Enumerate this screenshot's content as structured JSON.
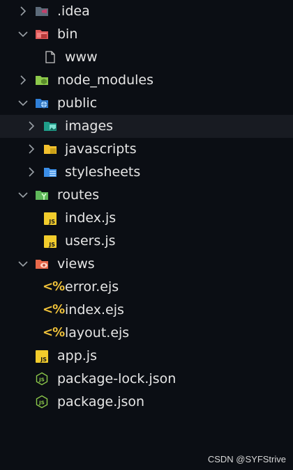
{
  "tree": {
    "idea": {
      "label": ".idea",
      "expanded": false,
      "icon": "idea-folder-icon"
    },
    "bin": {
      "label": "bin",
      "expanded": true,
      "icon": "bin-folder-icon"
    },
    "www": {
      "label": "www",
      "icon": "file-icon"
    },
    "node_modules": {
      "label": "node_modules",
      "expanded": false,
      "icon": "node-modules-folder-icon"
    },
    "public": {
      "label": "public",
      "expanded": true,
      "icon": "public-folder-icon"
    },
    "images": {
      "label": "images",
      "expanded": false,
      "icon": "images-folder-icon"
    },
    "javascripts": {
      "label": "javascripts",
      "expanded": false,
      "icon": "javascripts-folder-icon"
    },
    "stylesheets": {
      "label": "stylesheets",
      "expanded": false,
      "icon": "stylesheets-folder-icon"
    },
    "routes": {
      "label": "routes",
      "expanded": true,
      "icon": "routes-folder-icon"
    },
    "routes_index": {
      "label": "index.js",
      "icon": "js-file-icon",
      "badge": "JS"
    },
    "routes_users": {
      "label": "users.js",
      "icon": "js-file-icon",
      "badge": "JS"
    },
    "views": {
      "label": "views",
      "expanded": true,
      "icon": "views-folder-icon"
    },
    "views_error": {
      "label": "error.ejs",
      "icon": "ejs-file-icon",
      "badge": "<%"
    },
    "views_index": {
      "label": "index.ejs",
      "icon": "ejs-file-icon",
      "badge": "<%"
    },
    "views_layout": {
      "label": "layout.ejs",
      "icon": "ejs-file-icon",
      "badge": "<%"
    },
    "app": {
      "label": "app.js",
      "icon": "js-file-icon",
      "badge": "JS"
    },
    "package_lock": {
      "label": "package-lock.json",
      "icon": "nodejs-file-icon"
    },
    "package": {
      "label": "package.json",
      "icon": "nodejs-file-icon"
    }
  },
  "watermark": "CSDN @SYFStrive",
  "colors": {
    "background": "#0b0e14",
    "hover_row": "#181b22",
    "text": "#e6e6e6",
    "chevron": "#9aa0a6",
    "js_badge": "#f2cc2c",
    "ejs_badge": "#f0c23a",
    "nodejs_green": "#8cc84b"
  }
}
